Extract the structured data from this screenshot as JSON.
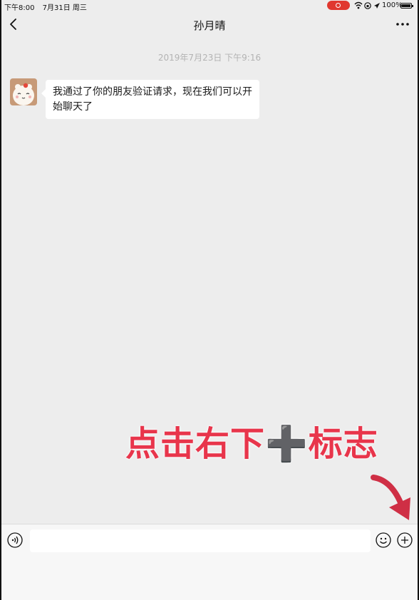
{
  "status_bar": {
    "time": "下午8:00",
    "date": "7月31日 周三",
    "battery": "100%"
  },
  "nav": {
    "title": "孙月晴"
  },
  "chat": {
    "timestamp": "2019年7月23日 下午9:16",
    "messages": [
      {
        "sender": "other",
        "text": "我通过了你的朋友验证请求，现在我们可以开始聊天了"
      }
    ]
  },
  "annotation": {
    "part1": "点击右下",
    "plus": "➕",
    "part2": "标志"
  },
  "colors": {
    "background": "#ededed",
    "annotation_red": "#e8354b",
    "record_red": "#e0382f"
  },
  "icons": [
    "back-icon",
    "more-icon",
    "voice-icon",
    "emoji-icon",
    "plus-icon"
  ]
}
